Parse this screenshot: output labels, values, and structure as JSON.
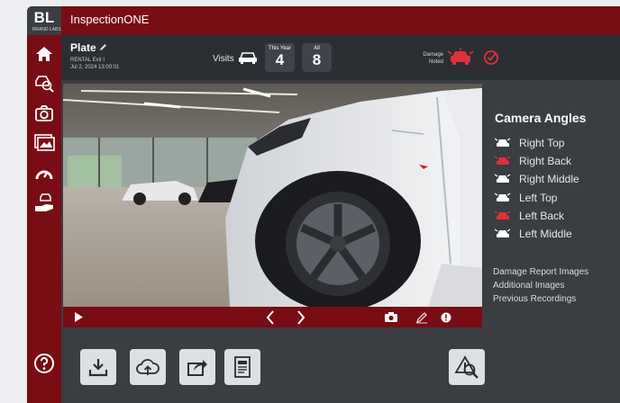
{
  "app": {
    "logo": "BL",
    "logo_sub": "BRAND LABS",
    "title": "InspectionONE"
  },
  "vehicle": {
    "plate": "Plate",
    "location": "RENTAL Exit I",
    "datetime": "Jul 2, 2024 13:00:01"
  },
  "visits": {
    "label": "Visits",
    "this_year_label": "This Year",
    "this_year_value": "4",
    "all_label": "All",
    "all_value": "8"
  },
  "damage": {
    "line1": "Damage",
    "line2": "Noted"
  },
  "camera_angles": {
    "title": "Camera Angles",
    "items": [
      {
        "label": "Right Top",
        "color": "#ffffff"
      },
      {
        "label": "Right Back",
        "color": "#e0303a"
      },
      {
        "label": "Right Middle",
        "color": "#ffffff"
      },
      {
        "label": "Left Top",
        "color": "#ffffff"
      },
      {
        "label": "Left Back",
        "color": "#e0303a"
      },
      {
        "label": "Left Middle",
        "color": "#ffffff"
      }
    ]
  },
  "links": [
    "Damage Report Images",
    "Additional Images",
    "Previous Recordings"
  ],
  "colors": {
    "brand": "#7a0c14",
    "panel": "#3a3d42",
    "header": "#2b2e33",
    "alert": "#e0303a"
  }
}
